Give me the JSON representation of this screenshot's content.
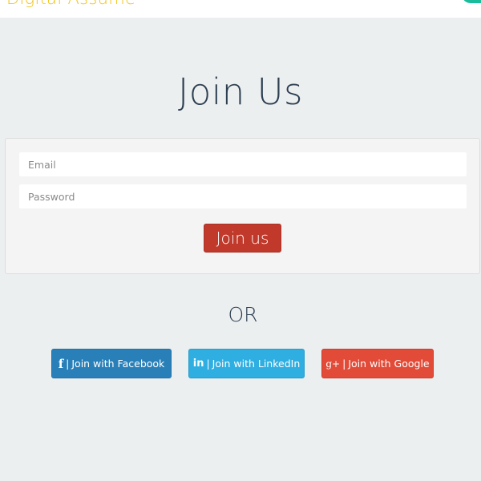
{
  "header": {
    "brand": "Digital Assume",
    "accent_color": "#f3c418",
    "nav_pill_color": "#1abc9c"
  },
  "main": {
    "title": "Join Us",
    "form": {
      "email_placeholder": "Email",
      "email_value": "",
      "password_placeholder": "Password",
      "password_value": "",
      "submit_label": "Join us",
      "submit_color": "#c0392b"
    },
    "divider_text": "OR",
    "social": [
      {
        "icon": "facebook-icon",
        "glyph": "f",
        "separator": "|",
        "label": "Join with Facebook",
        "color": "#2980b9"
      },
      {
        "icon": "linkedin-icon",
        "glyph": "in",
        "separator": "|",
        "label": "Join with LinkedIn",
        "color": "#2eaee1"
      },
      {
        "icon": "google-plus-icon",
        "glyph": "g+",
        "separator": "|",
        "label": "Join with Google",
        "color": "#e24b37"
      }
    ]
  }
}
